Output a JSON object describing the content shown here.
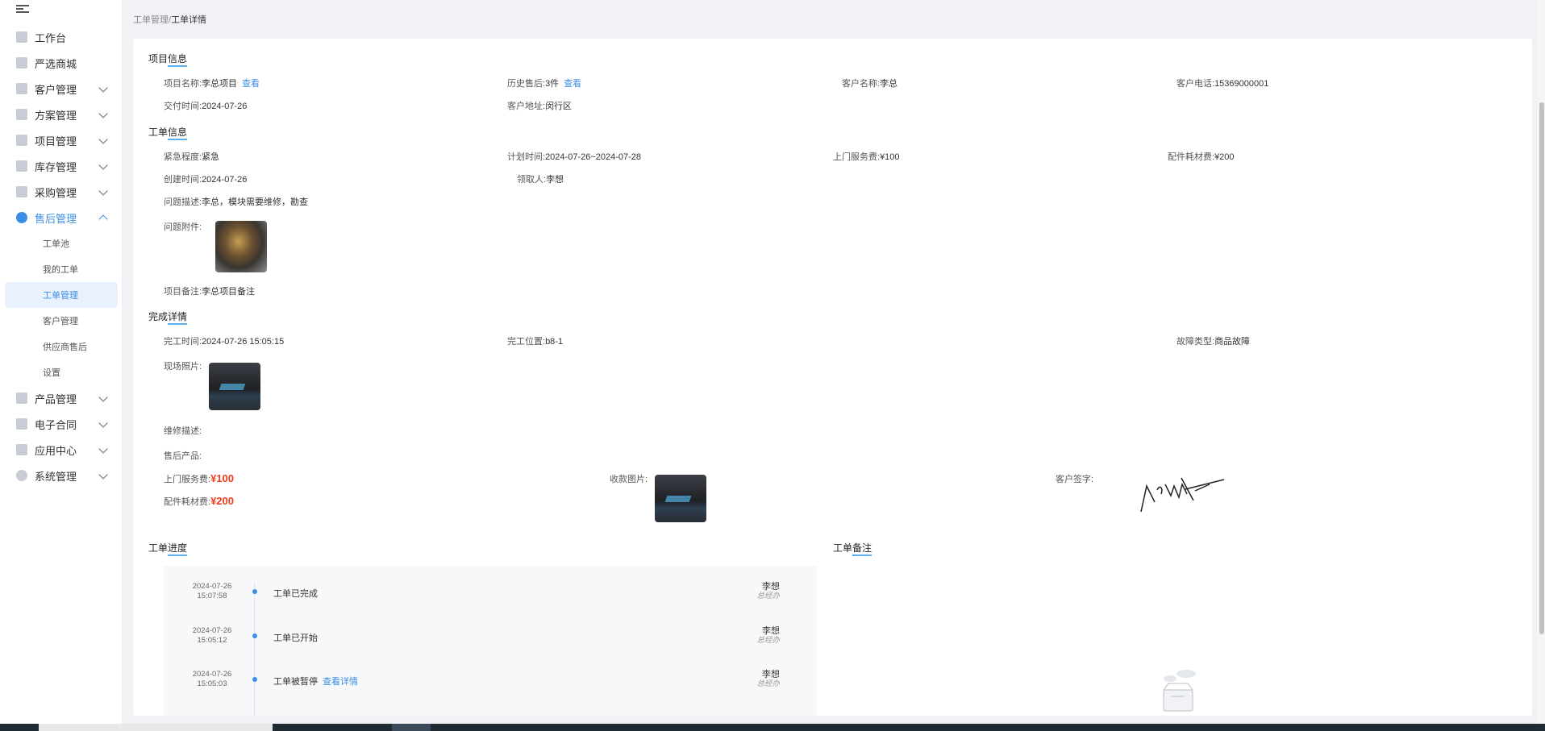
{
  "sidebar": {
    "items": [
      {
        "label": "工作台"
      },
      {
        "label": "严选商城"
      },
      {
        "label": "客户管理"
      },
      {
        "label": "方案管理"
      },
      {
        "label": "项目管理"
      },
      {
        "label": "库存管理"
      },
      {
        "label": "采购管理"
      },
      {
        "label": "售后管理"
      },
      {
        "label": "产品管理"
      },
      {
        "label": "电子合同"
      },
      {
        "label": "应用中心"
      },
      {
        "label": "系统管理"
      }
    ],
    "sub_items": [
      {
        "label": "工单池"
      },
      {
        "label": "我的工单"
      },
      {
        "label": "工单管理"
      },
      {
        "label": "客户管理"
      },
      {
        "label": "供应商售后"
      },
      {
        "label": "设置"
      }
    ]
  },
  "breadcrumb": {
    "parent": "工单管理",
    "sep": "/",
    "current": "工单详情"
  },
  "project_info": {
    "title": "项目信息",
    "name_label": "项目名称:",
    "name_value": "李总项目",
    "name_link": "查看",
    "history_label": "历史售后:",
    "history_value": "3件",
    "history_link": "查看",
    "customer_label": "客户名称:",
    "customer_value": "李总",
    "phone_label": "客户电话:",
    "phone_value": "15369000001",
    "delivery_label": "交付时间:",
    "delivery_value": "2024-07-26",
    "address_label": "客户地址:",
    "address_value": "闵行区"
  },
  "order_info": {
    "title": "工单信息",
    "urgency_label": "紧急程度:",
    "urgency_value": "紧急",
    "plan_label": "计划时间:",
    "plan_value": "2024-07-26~2024-07-28",
    "service_fee_label": "上门服务费:",
    "service_fee_value": "¥100",
    "parts_fee_label": "配件耗材费:",
    "parts_fee_value": "¥200",
    "created_label": "创建时间:",
    "created_value": "2024-07-26",
    "receiver_label": "领取人:",
    "receiver_value": "李想",
    "desc_label": "问题描述:",
    "desc_value": "李总，模块需要维修，勘查",
    "attach_label": "问题附件:",
    "note_label": "项目备注:",
    "note_value": "李总项目备注"
  },
  "completion": {
    "title": "完成详情",
    "time_label": "完工时间:",
    "time_value": "2024-07-26 15:05:15",
    "location_label": "完工位置:",
    "location_value": "b8-1",
    "fault_label": "故障类型:",
    "fault_value": "商品故障",
    "photo_label": "现场照片:",
    "repair_label": "维修描述:",
    "product_label": "售后产品:",
    "service_fee_label": "上门服务费:",
    "service_fee_value": "¥100",
    "parts_fee_label": "配件耗材费:",
    "parts_fee_value": "¥200",
    "payment_label": "收款图片:",
    "signature_label": "客户签字:"
  },
  "progress": {
    "title": "工单进度",
    "events": [
      {
        "date": "2024-07-26",
        "time": "15:07:58",
        "text": "工单已完成",
        "link": "",
        "user": "李想",
        "role": "总经办"
      },
      {
        "date": "2024-07-26",
        "time": "15:05:12",
        "text": "工单已开始",
        "link": "",
        "user": "李想",
        "role": "总经办"
      },
      {
        "date": "2024-07-26",
        "time": "15:05:03",
        "text": "工单被暂停",
        "link": "查看详情",
        "user": "李想",
        "role": "总经办"
      }
    ]
  },
  "remarks": {
    "title": "工单备注"
  },
  "colors": {
    "accent": "#3a8ee6",
    "price": "#f03c1c",
    "underline": "#5ab0f0"
  }
}
